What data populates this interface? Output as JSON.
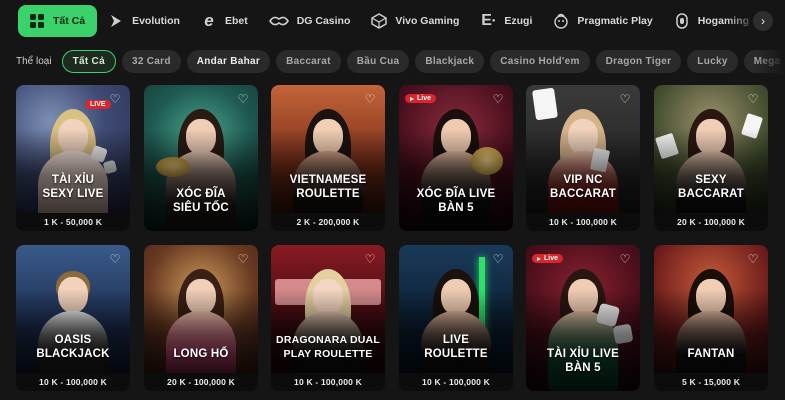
{
  "colors": {
    "accent": "#3bd16b",
    "background": "#151515",
    "live": "#d7262c",
    "chip": "#2a2a2a"
  },
  "providers": [
    {
      "label": "Tất Cả",
      "icon": "grid-icon",
      "active": true
    },
    {
      "label": "Evolution",
      "icon": "evolution-logo-icon"
    },
    {
      "label": "Ebet",
      "icon": "ebet-logo-icon"
    },
    {
      "label": "DG Casino",
      "icon": "dg-casino-logo-icon"
    },
    {
      "label": "Vivo Gaming",
      "icon": "vivo-gaming-logo-icon"
    },
    {
      "label": "Ezugi",
      "icon": "ezugi-logo-icon"
    },
    {
      "label": "Pragmatic Play",
      "icon": "pragmatic-play-logo-icon"
    },
    {
      "label": "Hogaming",
      "icon": "hogaming-logo-icon"
    }
  ],
  "providers_next_icon": "chevron-right-icon",
  "filter": {
    "label": "Thể loại",
    "chips": [
      {
        "label": "Tất Cả",
        "active": true
      },
      {
        "label": "32 Card"
      },
      {
        "label": "Andar Bahar"
      },
      {
        "label": "Baccarat"
      },
      {
        "label": "Bầu Cua"
      },
      {
        "label": "Blackjack"
      },
      {
        "label": "Casino Hold'em"
      },
      {
        "label": "Dragon Tiger"
      },
      {
        "label": "Lucky"
      },
      {
        "label": "Mega Sic B"
      }
    ]
  },
  "games": [
    {
      "title": "TÀI XỈU\nSEXY LIVE",
      "range": "1 K - 50,000 K",
      "live": "LIVE"
    },
    {
      "title": "XÓC ĐĨA\nSIÊU TỐC",
      "range": ""
    },
    {
      "title": "VIETNAMESE\nROULETTE",
      "range": "2 K - 200,000 K"
    },
    {
      "title": "XÓC ĐĨA LIVE\nBÀN 5",
      "range": "",
      "live": "Live"
    },
    {
      "title": "VIP NC\nBACCARAT",
      "range": "10 K - 100,000 K"
    },
    {
      "title": "SEXY\nBACCARAT",
      "range": "20 K - 100,000 K"
    },
    {
      "title": "OASIS\nBLACKJACK",
      "range": "10 K - 100,000 K"
    },
    {
      "title": "LONG HỔ",
      "range": "20 K - 100,000 K"
    },
    {
      "title": "DRAGONARA DUAL\nPLAY ROULETTE",
      "range": "10 K - 100,000 K"
    },
    {
      "title": "LIVE\nROULETTE",
      "range": "10 K - 100,000 K"
    },
    {
      "title": "TÀI XỈU LIVE\nBÀN 5",
      "range": "",
      "live": "Live"
    },
    {
      "title": "FANTAN",
      "range": "5 K - 15,000 K"
    }
  ],
  "favorite_icon": "heart-icon"
}
